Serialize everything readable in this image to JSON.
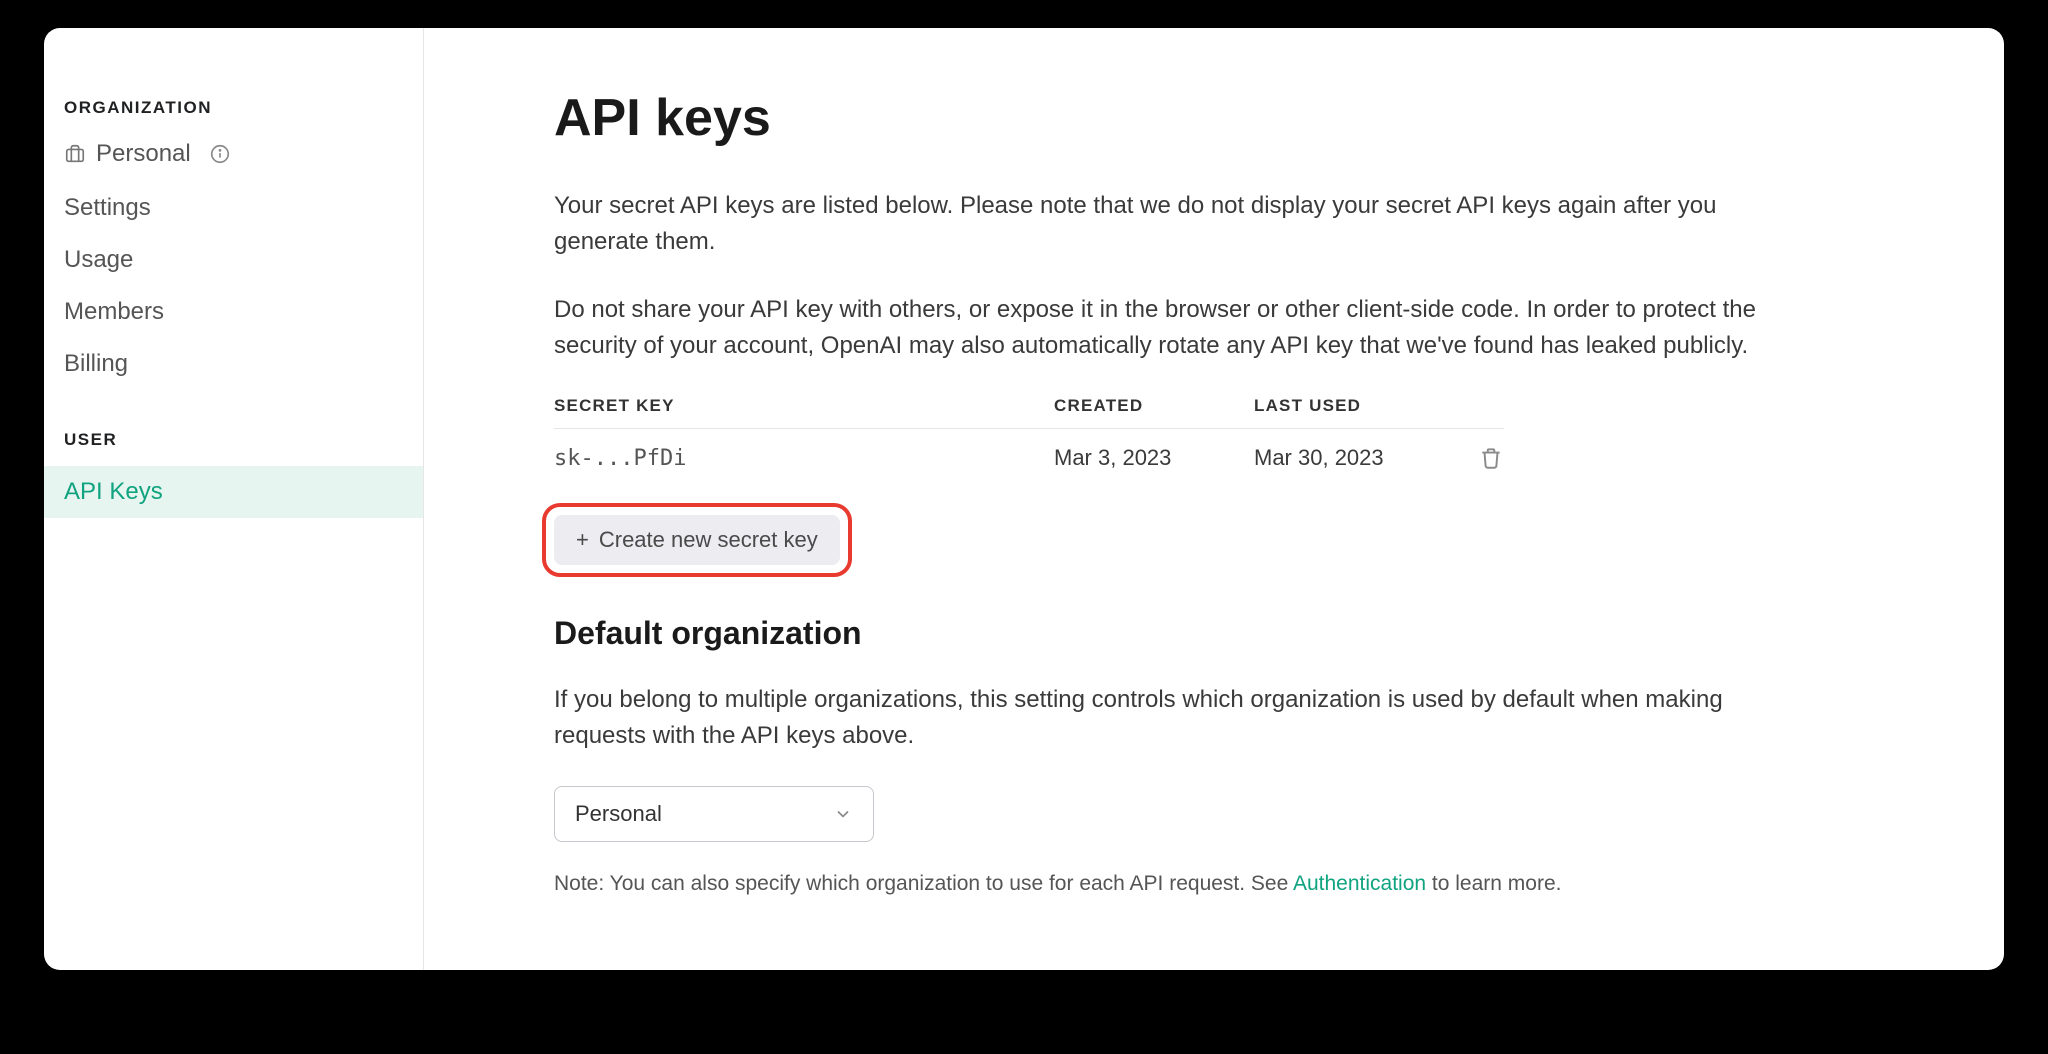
{
  "sidebar": {
    "org_section_label": "ORGANIZATION",
    "org_name": "Personal",
    "nav": {
      "settings": "Settings",
      "usage": "Usage",
      "members": "Members",
      "billing": "Billing"
    },
    "user_section_label": "USER",
    "user_nav": {
      "api_keys": "API Keys"
    }
  },
  "main": {
    "title": "API keys",
    "intro_1": "Your secret API keys are listed below. Please note that we do not display your secret API keys again after you generate them.",
    "intro_2": "Do not share your API key with others, or expose it in the browser or other client-side code. In order to protect the security of your account, OpenAI may also automatically rotate any API key that we've found has leaked publicly.",
    "table": {
      "headers": {
        "secret_key": "SECRET KEY",
        "created": "CREATED",
        "last_used": "LAST USED"
      },
      "rows": [
        {
          "key": "sk-...PfDi",
          "created": "Mar 3, 2023",
          "last_used": "Mar 30, 2023"
        }
      ]
    },
    "create_button": "Create new secret key",
    "default_org": {
      "title": "Default organization",
      "desc": "If you belong to multiple organizations, this setting controls which organization is used by default when making requests with the API keys above.",
      "selected": "Personal",
      "note_prefix": "Note: You can also specify which organization to use for each API request. See ",
      "note_link": "Authentication",
      "note_suffix": " to learn more."
    }
  }
}
